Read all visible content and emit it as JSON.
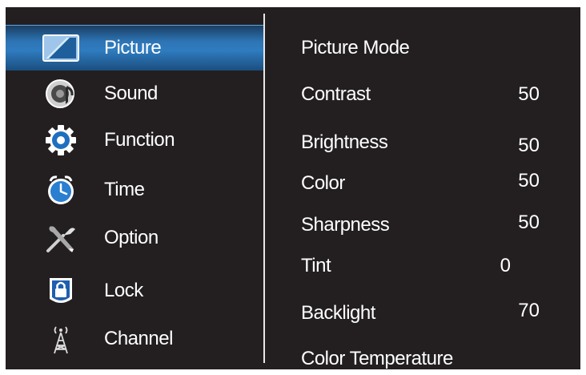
{
  "menu": {
    "items": [
      {
        "label": "Picture",
        "icon": "picture-icon",
        "active": true
      },
      {
        "label": "Sound",
        "icon": "speaker-icon",
        "active": false
      },
      {
        "label": "Function",
        "icon": "gear-icon",
        "active": false
      },
      {
        "label": "Time",
        "icon": "clock-icon",
        "active": false
      },
      {
        "label": "Option",
        "icon": "tools-icon",
        "active": false
      },
      {
        "label": "Lock",
        "icon": "lock-icon",
        "active": false
      },
      {
        "label": "Channel",
        "icon": "antenna-icon",
        "active": false
      }
    ]
  },
  "picture_settings": {
    "rows": [
      {
        "label": "Picture Mode",
        "value": ""
      },
      {
        "label": "Contrast",
        "value": "50"
      },
      {
        "label": "Brightness",
        "value": "50"
      },
      {
        "label": "Color",
        "value": "50"
      },
      {
        "label": "Sharpness",
        "value": "50"
      },
      {
        "label": "Tint",
        "value": "0"
      },
      {
        "label": "Backlight",
        "value": "70"
      },
      {
        "label": "Color Temperature",
        "value": ""
      }
    ]
  },
  "colors": {
    "background": "#231f20",
    "highlight": "#2f7cc0",
    "text": "#ffffff"
  }
}
